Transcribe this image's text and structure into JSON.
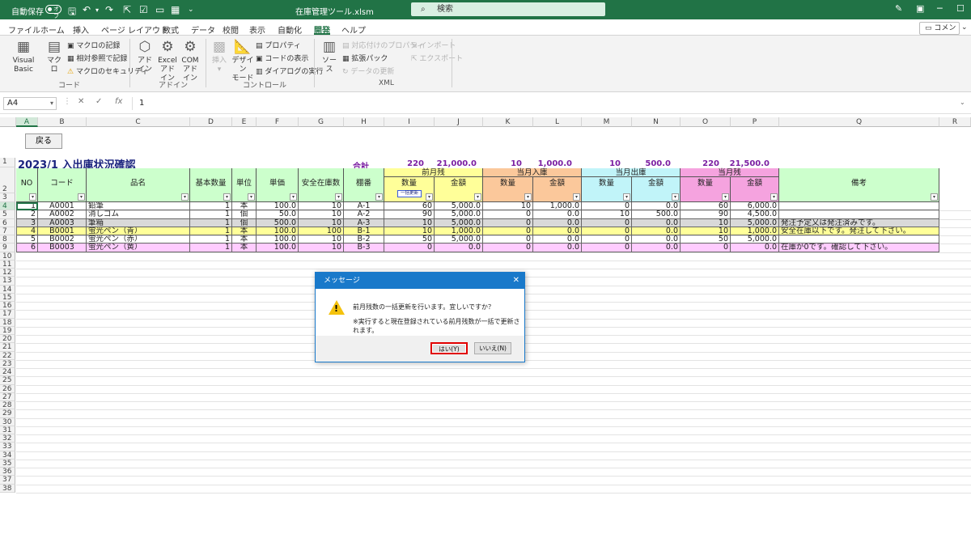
{
  "titlebar": {
    "autosave_label": "自動保存",
    "autosave_state": "オフ",
    "filename": "在庫管理ツール.xlsm",
    "search_placeholder": "検索"
  },
  "menu": [
    "ファイル",
    "ホーム",
    "挿入",
    "ページ レイアウト",
    "数式",
    "データ",
    "校閲",
    "表示",
    "自動化",
    "開発",
    "ヘルプ"
  ],
  "menu_active": "開発",
  "comment_button": "コメント",
  "ribbon": {
    "code": {
      "label": "コード",
      "visual_basic": "Visual Basic",
      "macro": "マクロ",
      "record_macro": "マクロの記録",
      "relative_ref": "相対参照で記録",
      "macro_security": "マクロのセキュリティ"
    },
    "addins": {
      "label": "アドイン",
      "addin_l1": "アド",
      "addin_l2": "イン",
      "excel_addin_l1": "Excel",
      "excel_addin_l2": "アドイン",
      "com_addin_l1": "COM",
      "com_addin_l2": "アドイン"
    },
    "controls": {
      "label": "コントロール",
      "insert": "挿入",
      "design_mode_l1": "デザイン",
      "design_mode_l2": "モード",
      "properties": "プロパティ",
      "view_code": "コードの表示",
      "run_dialog": "ダイアログの実行"
    },
    "xml": {
      "label": "XML",
      "source": "ソース",
      "map_properties": "対応付けのプロパティ",
      "expansion_pack": "拡張パック",
      "refresh_data": "データの更新",
      "import": "インポート",
      "export": "エクスポート"
    }
  },
  "formula_bar": {
    "name_box": "A4",
    "content": "1"
  },
  "columns": [
    "A",
    "B",
    "C",
    "D",
    "E",
    "F",
    "G",
    "H",
    "I",
    "J",
    "K",
    "L",
    "M",
    "N",
    "O",
    "P",
    "Q",
    "R"
  ],
  "rows": [
    "1",
    "2",
    "3",
    "4",
    "5",
    "6",
    "7",
    "8",
    "9",
    "10",
    "11",
    "12",
    "13",
    "14",
    "15",
    "16",
    "17",
    "18",
    "19",
    "20",
    "21",
    "22",
    "23",
    "24",
    "25",
    "26",
    "27",
    "28",
    "29",
    "30",
    "31",
    "32",
    "33",
    "34",
    "35",
    "36",
    "37",
    "38"
  ],
  "sheet": {
    "back_button": "戻る",
    "title": "2023/1 入出庫状況確認",
    "total_label": "合計",
    "totals": [
      "220",
      "21,000.0",
      "10",
      "1,000.0",
      "10",
      "500.0",
      "220",
      "21,500.0"
    ],
    "headers": {
      "no": "NO",
      "code": "コード",
      "name": "品名",
      "base_qty": "基本数量",
      "unit": "単位",
      "unit_price": "単価",
      "safety_stock": "安全在庫数",
      "shelf": "棚番",
      "prev_balance": "前月残",
      "in_month": "当月入庫",
      "out_month": "当月出庫",
      "balance": "当月残",
      "qty": "数量",
      "amount": "金額",
      "remarks": "備考",
      "bulk_update": "一括更新"
    },
    "data_rows": [
      {
        "no": "1",
        "code": "A0001",
        "name": "鉛筆",
        "base_qty": "1",
        "unit": "本",
        "price": "100.0",
        "safety": "10",
        "shelf": "A-1",
        "pq": "60",
        "pa": "5,000.0",
        "iq": "10",
        "ia": "1,000.0",
        "oq": "0",
        "oa": "0.0",
        "bq": "60",
        "ba": "6,000.0",
        "remarks": ""
      },
      {
        "no": "2",
        "code": "A0002",
        "name": "消しゴム",
        "base_qty": "1",
        "unit": "個",
        "price": "50.0",
        "safety": "10",
        "shelf": "A-2",
        "pq": "90",
        "pa": "5,000.0",
        "iq": "0",
        "ia": "0.0",
        "oq": "10",
        "oa": "500.0",
        "bq": "90",
        "ba": "4,500.0",
        "remarks": ""
      },
      {
        "no": "3",
        "code": "A0003",
        "name": "筆箱",
        "base_qty": "1",
        "unit": "個",
        "price": "500.0",
        "safety": "10",
        "shelf": "A-3",
        "pq": "10",
        "pa": "5,000.0",
        "iq": "0",
        "ia": "0.0",
        "oq": "0",
        "oa": "0.0",
        "bq": "10",
        "ba": "5,000.0",
        "remarks": "発注予定又は発注済みです。"
      },
      {
        "no": "4",
        "code": "B0001",
        "name": "蛍光ペン（青）",
        "base_qty": "1",
        "unit": "本",
        "price": "100.0",
        "safety": "100",
        "shelf": "B-1",
        "pq": "10",
        "pa": "1,000.0",
        "iq": "0",
        "ia": "0.0",
        "oq": "0",
        "oa": "0.0",
        "bq": "10",
        "ba": "1,000.0",
        "remarks": "安全在庫以下です。発注して下さい。"
      },
      {
        "no": "5",
        "code": "B0002",
        "name": "蛍光ペン（赤）",
        "base_qty": "1",
        "unit": "本",
        "price": "100.0",
        "safety": "10",
        "shelf": "B-2",
        "pq": "50",
        "pa": "5,000.0",
        "iq": "0",
        "ia": "0.0",
        "oq": "0",
        "oa": "0.0",
        "bq": "50",
        "ba": "5,000.0",
        "remarks": ""
      },
      {
        "no": "6",
        "code": "B0003",
        "name": "蛍光ペン（黄）",
        "base_qty": "1",
        "unit": "本",
        "price": "100.0",
        "safety": "10",
        "shelf": "B-3",
        "pq": "0",
        "pa": "0.0",
        "iq": "0",
        "ia": "0.0",
        "oq": "0",
        "oa": "0.0",
        "bq": "0",
        "ba": "0.0",
        "remarks": "在庫が0です。確認して下さい。"
      }
    ]
  },
  "dialog": {
    "title": "メッセージ",
    "message": "前月残数の一括更新を行います。宜しいですか？",
    "note": "※実行すると現在登録されている前月残数が一括で更新されます。",
    "yes": "はい(Y)",
    "no": "いいえ(N)"
  }
}
